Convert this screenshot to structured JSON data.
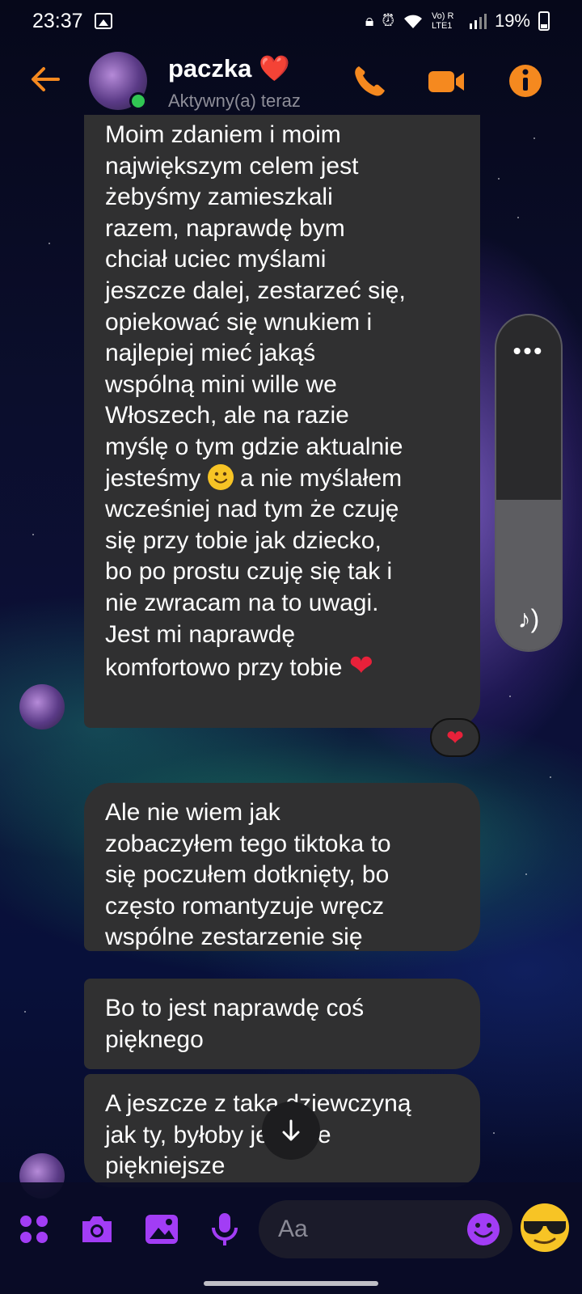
{
  "status_bar": {
    "time": "23:37",
    "network": "Vo) R LTE1",
    "battery": "19%"
  },
  "header": {
    "contact_name": "paczka",
    "name_emoji": "❤️",
    "contact_status": "Aktywny(a) teraz"
  },
  "messages": [
    {
      "lines": [
        "Moim zdaniem i moim",
        "największym celem jest",
        "żebyśmy zamieszkali",
        "razem, naprawdę bym",
        "chciał uciec myślami",
        "jeszcze dalej, zestarzeć się,",
        "opiekować się wnukiem i",
        "najlepiej mieć jakąś",
        "wspólną mini wille we",
        "Włoszech, ale na razie",
        "myślę o tym gdzie aktualnie"
      ],
      "line_emoji_before": "jesteśmy",
      "line_emoji_after": "a nie myślałem",
      "lines_after": [
        "wcześniej nad tym że czuję",
        "się przy tobie jak dziecko,",
        "bo po prostu czuję się tak i",
        "nie zwracam na to uwagi.",
        "Jest mi naprawdę"
      ],
      "last_line": "komfortowo przy tobie",
      "last_emoji": "❤",
      "reaction": "❤"
    },
    {
      "lines": [
        "Ale nie wiem jak",
        "zobaczyłem tego tiktoka to",
        "się poczułem dotknięty, bo",
        "często romantyzuje wręcz",
        "wspólne zestarzenie się"
      ]
    },
    {
      "lines": [
        "Bo to jest naprawdę coś",
        "pięknego"
      ]
    },
    {
      "lines": [
        "A jeszcze z taką dziewczyną",
        "jak ty, byłoby jeszcze",
        "piękniejsze"
      ]
    }
  ],
  "volume_panel": {
    "menu_glyph": "•••",
    "level": 0.45,
    "note_glyph": "♪)"
  },
  "composer": {
    "placeholder": "Aa",
    "icons": [
      "apps-icon",
      "camera-icon",
      "gallery-icon",
      "microphone-icon",
      "emoji-icon",
      "cool-emoji"
    ]
  },
  "colors": {
    "accent_header": "#f5891f",
    "accent_composer": "#a23df5",
    "bubble": "#303031",
    "online": "#31c653"
  }
}
